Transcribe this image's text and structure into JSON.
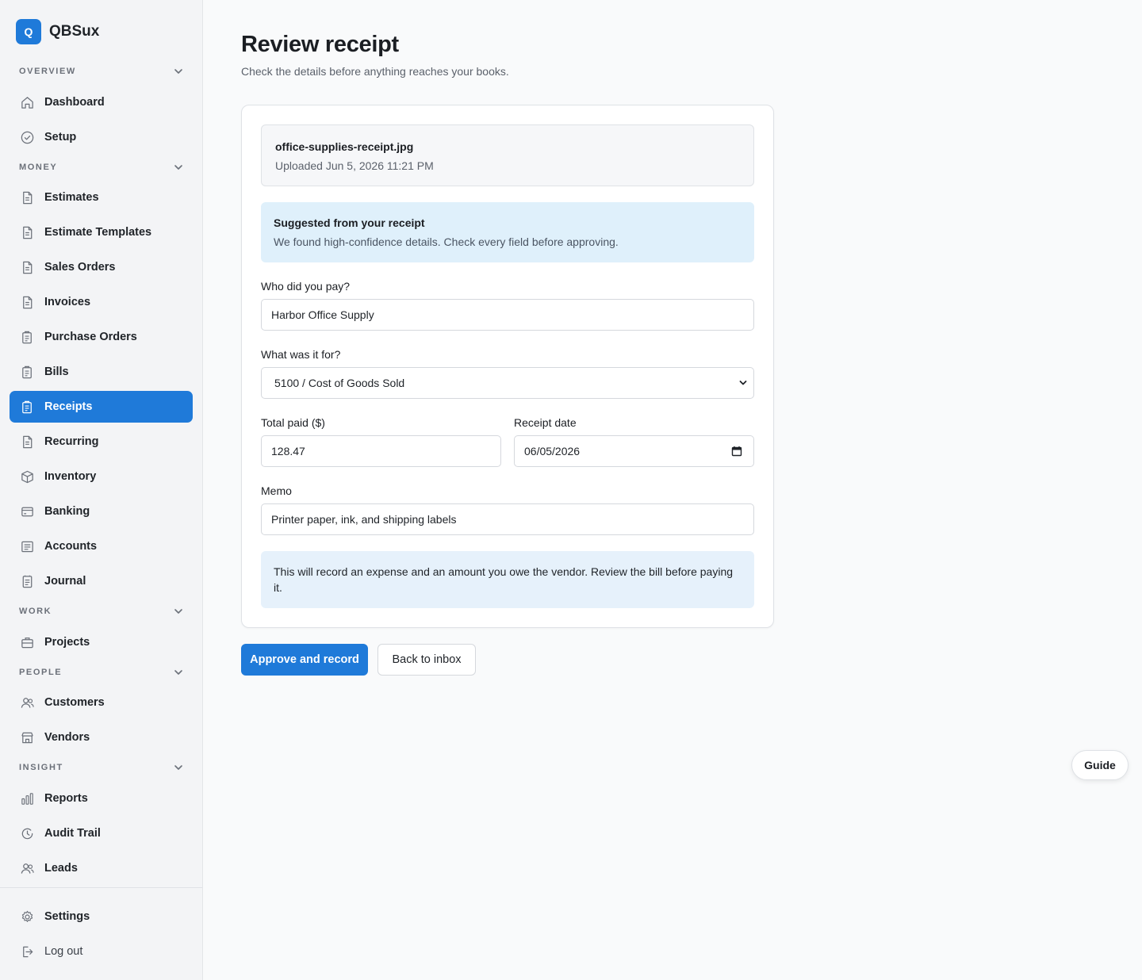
{
  "brand": {
    "logo_letter": "Q",
    "name": "QBSux",
    "accent": "#1f7ad9"
  },
  "sidebar": {
    "sections": {
      "overview": "OVERVIEW",
      "money": "MONEY",
      "work": "WORK",
      "people": "PEOPLE",
      "insight": "INSIGHT"
    },
    "items": {
      "dashboard": {
        "label": "Dashboard",
        "icon": "home-icon"
      },
      "setup": {
        "label": "Setup",
        "icon": "check-circle-icon"
      },
      "estimates": {
        "label": "Estimates",
        "icon": "document-icon"
      },
      "estimate_templates": {
        "label": "Estimate Templates",
        "icon": "document-icon"
      },
      "sales_orders": {
        "label": "Sales Orders",
        "icon": "document-icon"
      },
      "invoices": {
        "label": "Invoices",
        "icon": "document-icon"
      },
      "purchase_orders": {
        "label": "Purchase Orders",
        "icon": "clipboard-icon"
      },
      "bills": {
        "label": "Bills",
        "icon": "clipboard-icon"
      },
      "receipts": {
        "label": "Receipts",
        "icon": "clipboard-icon",
        "active": true
      },
      "recurring": {
        "label": "Recurring",
        "icon": "document-icon"
      },
      "inventory": {
        "label": "Inventory",
        "icon": "box-icon"
      },
      "banking": {
        "label": "Banking",
        "icon": "bank-card-icon"
      },
      "accounts": {
        "label": "Accounts",
        "icon": "ledger-icon"
      },
      "journal": {
        "label": "Journal",
        "icon": "journal-icon"
      },
      "projects": {
        "label": "Projects",
        "icon": "briefcase-icon"
      },
      "customers": {
        "label": "Customers",
        "icon": "users-icon"
      },
      "vendors": {
        "label": "Vendors",
        "icon": "store-icon"
      },
      "reports": {
        "label": "Reports",
        "icon": "bar-chart-icon"
      },
      "audit_trail": {
        "label": "Audit Trail",
        "icon": "history-icon"
      },
      "leads": {
        "label": "Leads",
        "icon": "users-icon"
      },
      "settings": {
        "label": "Settings",
        "icon": "gear-icon"
      },
      "logout": {
        "label": "Log out",
        "icon": "logout-icon"
      }
    }
  },
  "page": {
    "title": "Review receipt",
    "subtitle": "Check the details before anything reaches your books."
  },
  "file": {
    "name": "office-supplies-receipt.jpg",
    "meta": "Uploaded Jun 5, 2026 11:21 PM"
  },
  "suggestion": {
    "title": "Suggested from your receipt",
    "text": "We found high-confidence details. Check every field before approving."
  },
  "form": {
    "payee_label": "Who did you pay?",
    "payee_value": "Harbor Office Supply",
    "category_label": "What was it for?",
    "category_value": "5100 / Cost of Goods Sold",
    "total_label": "Total paid ($)",
    "total_value": "128.47",
    "date_label": "Receipt date",
    "date_value": "06/05/2026",
    "memo_label": "Memo",
    "memo_value": "Printer paper, ink, and shipping labels"
  },
  "info": {
    "text": "This will record an expense and an amount you owe the vendor. Review the bill before paying it."
  },
  "actions": {
    "approve": "Approve and record",
    "back": "Back to inbox",
    "guide": "Guide"
  }
}
